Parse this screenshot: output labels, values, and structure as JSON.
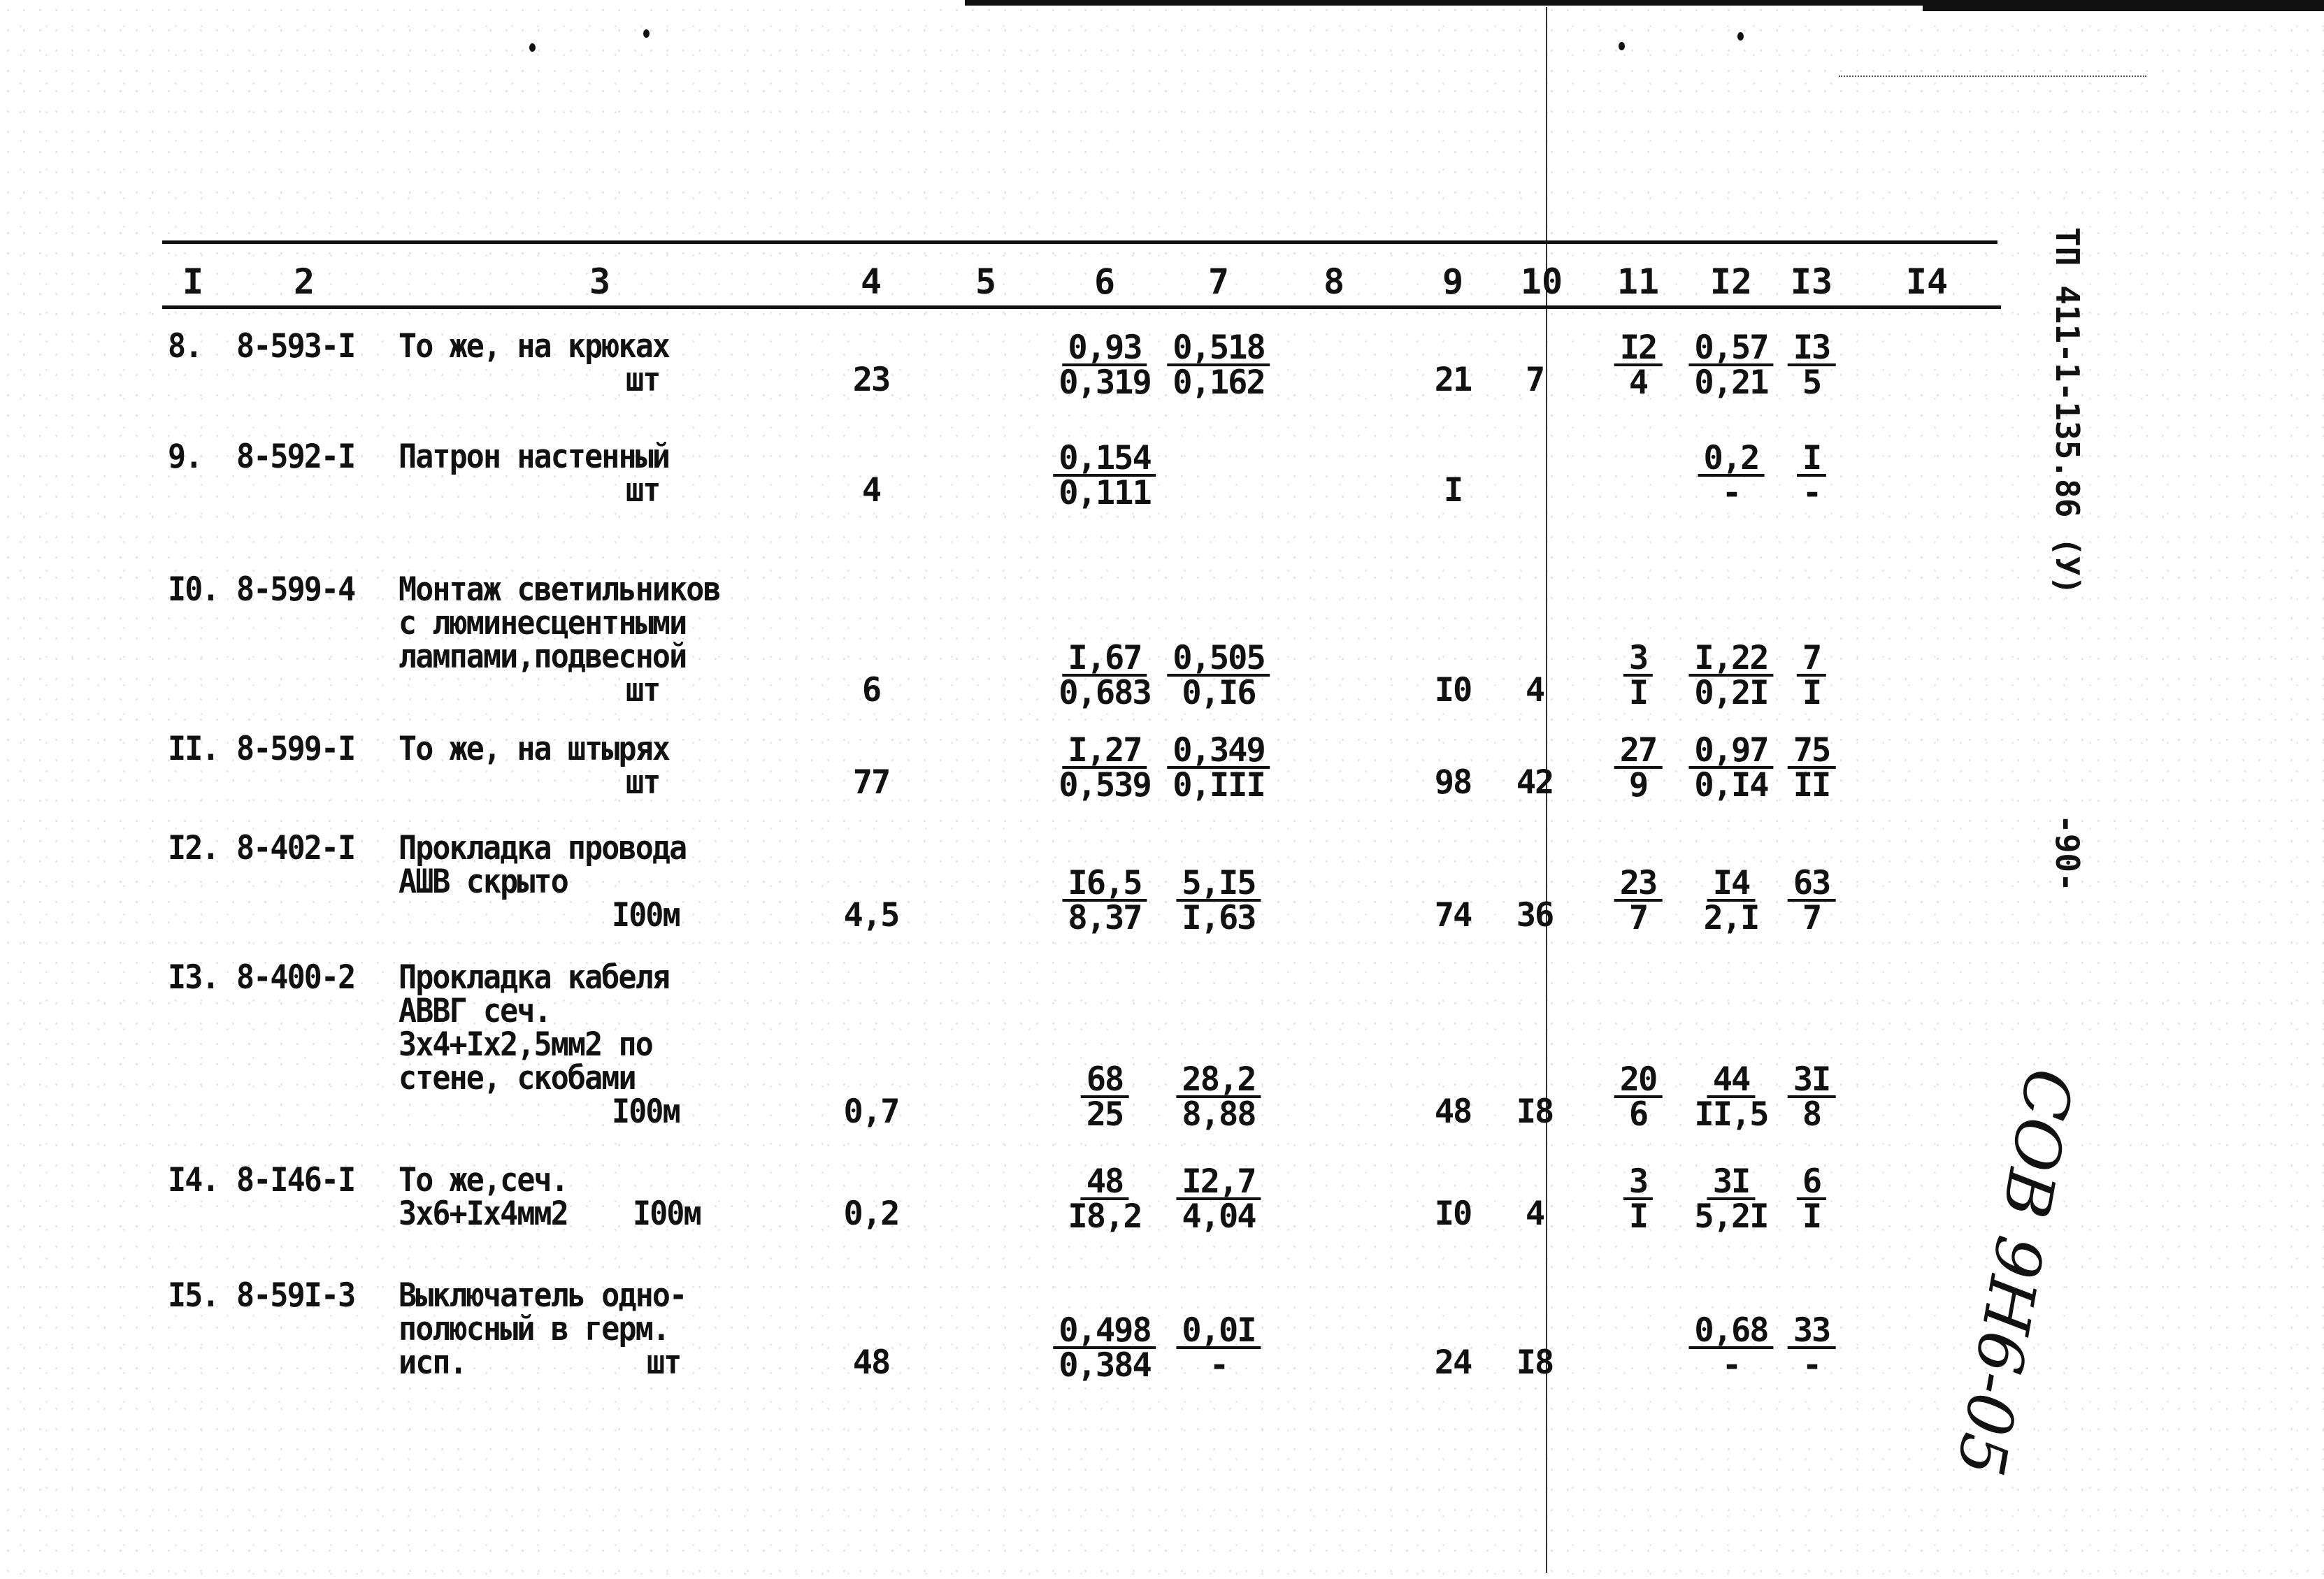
{
  "document": {
    "side_code": "ТП 411-1-135.86 (У)",
    "page_number": "-90-",
    "handwritten_note": "СОВ 9Н6-05"
  },
  "table": {
    "column_headers": [
      "I",
      "2",
      "3",
      "4",
      "5",
      "6",
      "7",
      "8",
      "9",
      "10",
      "11",
      "I2",
      "I3",
      "I4"
    ],
    "rows": [
      {
        "num": "8.",
        "code": "8-593-I",
        "desc": [
          "То же, на крюках"
        ],
        "unit": "шт",
        "c4": "23",
        "c6": {
          "num": "0,93",
          "den": "0,319"
        },
        "c7": {
          "num": "0,518",
          "den": "0,162"
        },
        "c9": "21",
        "c10": "7",
        "c11": {
          "num": "I2",
          "den": "4"
        },
        "c12": {
          "num": "0,57",
          "den": "0,21"
        },
        "c13": {
          "num": "I3",
          "den": "5"
        }
      },
      {
        "num": "9.",
        "code": "8-592-I",
        "desc": [
          "Патрон настенный"
        ],
        "unit": "шт",
        "c4": "4",
        "c6": {
          "num": "0,154",
          "den": "0,111"
        },
        "c7": null,
        "c9": "I",
        "c10": "",
        "c11": null,
        "c12": {
          "num": "0,2",
          "den": "-"
        },
        "c13": {
          "num": "I",
          "den": "-"
        }
      },
      {
        "num": "I0.",
        "code": "8-599-4",
        "desc": [
          "Монтаж светильников",
          "с люминесцентными",
          "лампами,подвесной"
        ],
        "unit": "шт",
        "c4": "6",
        "c6": {
          "num": "I,67",
          "den": "0,683"
        },
        "c7": {
          "num": "0,505",
          "den": "0,I6"
        },
        "c9": "I0",
        "c10": "4",
        "c11": {
          "num": "3",
          "den": "I"
        },
        "c12": {
          "num": "I,22",
          "den": "0,2I"
        },
        "c13": {
          "num": "7",
          "den": "I"
        }
      },
      {
        "num": "II.",
        "code": "8-599-I",
        "desc": [
          "То же, на штырях"
        ],
        "unit": "шт",
        "c4": "77",
        "c6": {
          "num": "I,27",
          "den": "0,539"
        },
        "c7": {
          "num": "0,349",
          "den": "0,III"
        },
        "c9": "98",
        "c10": "42",
        "c11": {
          "num": "27",
          "den": "9"
        },
        "c12": {
          "num": "0,97",
          "den": "0,I4"
        },
        "c13": {
          "num": "75",
          "den": "II"
        }
      },
      {
        "num": "I2.",
        "code": "8-402-I",
        "desc": [
          "Прокладка провода",
          "АШВ скрыто"
        ],
        "unit": "I00м",
        "c4": "4,5",
        "c6": {
          "num": "I6,5",
          "den": "8,37"
        },
        "c7": {
          "num": "5,I5",
          "den": "I,63"
        },
        "c9": "74",
        "c10": "36",
        "c11": {
          "num": "23",
          "den": "7"
        },
        "c12": {
          "num": "I4",
          "den": "2,I"
        },
        "c13": {
          "num": "63",
          "den": "7"
        }
      },
      {
        "num": "I3.",
        "code": "8-400-2",
        "desc": [
          "Прокладка кабеля",
          "АВВГ сеч.",
          "3х4+Iх2,5мм2 по",
          "стене, скобами"
        ],
        "unit": "I00м",
        "c4": "0,7",
        "c6": {
          "num": "68",
          "den": "25"
        },
        "c7": {
          "num": "28,2",
          "den": "8,88"
        },
        "c9": "48",
        "c10": "I8",
        "c11": {
          "num": "20",
          "den": "6"
        },
        "c12": {
          "num": "44",
          "den": "II,5"
        },
        "c13": {
          "num": "3I",
          "den": "8"
        }
      },
      {
        "num": "I4.",
        "code": "8-I46-I",
        "desc": [
          "То же,сеч.",
          "3х6+Iх4мм2"
        ],
        "unit": "I00м",
        "c4": "0,2",
        "c6": {
          "num": "48",
          "den": "I8,2"
        },
        "c7": {
          "num": "I2,7",
          "den": "4,04"
        },
        "c9": "I0",
        "c10": "4",
        "c11": {
          "num": "3",
          "den": "I"
        },
        "c12": {
          "num": "3I",
          "den": "5,2I"
        },
        "c13": {
          "num": "6",
          "den": "I"
        }
      },
      {
        "num": "I5.",
        "code": "8-59I-3",
        "desc": [
          "Выключатель одно-",
          "полюсный в герм.",
          "исп."
        ],
        "unit": "шт",
        "c4": "48",
        "c6": {
          "num": "0,498",
          "den": "0,384"
        },
        "c7": {
          "num": "0,0I",
          "den": "-"
        },
        "c9": "24",
        "c10": "I8",
        "c11": null,
        "c12": {
          "num": "0,68",
          "den": "-"
        },
        "c13": {
          "num": "33",
          "den": "-"
        }
      }
    ]
  }
}
